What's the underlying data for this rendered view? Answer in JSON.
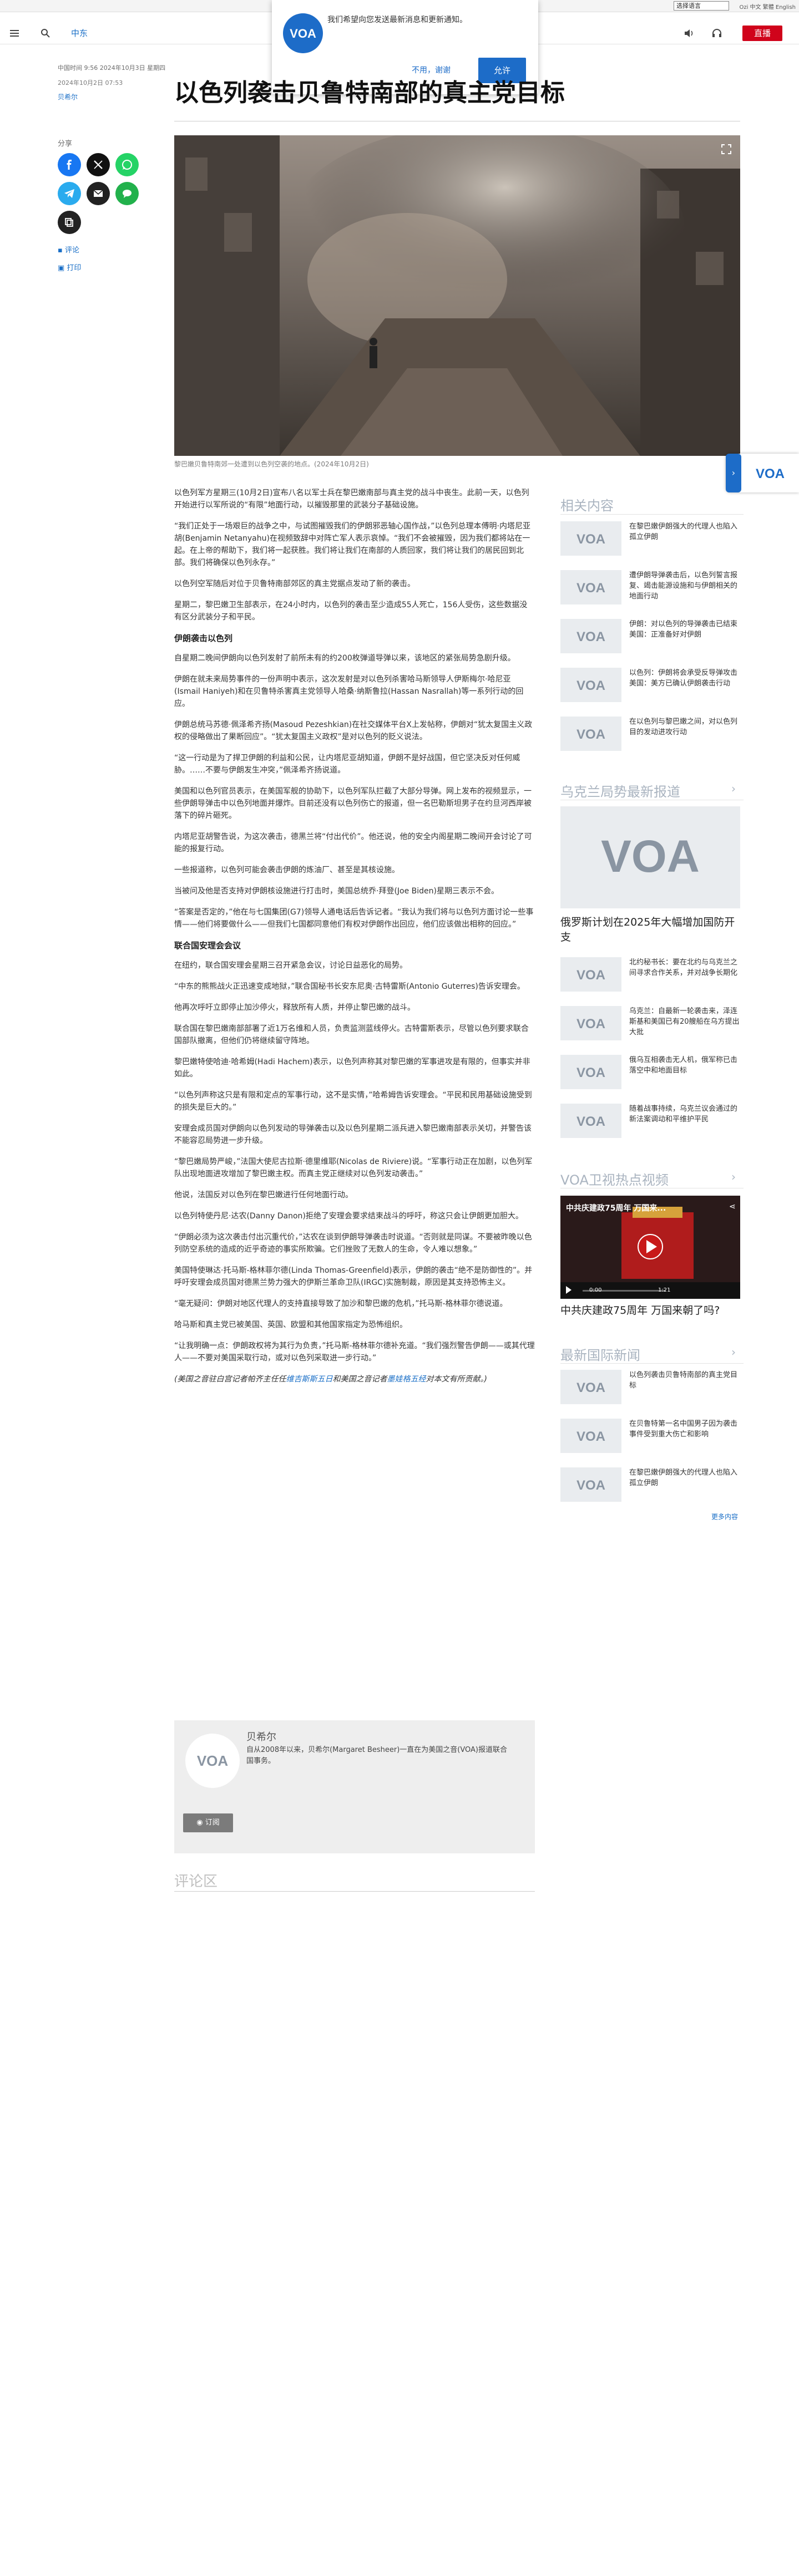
{
  "topbar": {
    "language_select": "选择语言",
    "links": "Ozi 中文 繁體 English"
  },
  "header": {
    "section": "中东",
    "live": "直播"
  },
  "notification": {
    "text": "我们希望向您发送最新消息和更新通知。",
    "later": "不用，谢谢",
    "allow": "允许"
  },
  "article": {
    "meta_lines": [
      "中国时间 9:56 2024年10月3日 星期四",
      "2024年10月2日 07:53"
    ],
    "author": "贝希尔",
    "headline": "以色列袭击贝鲁特南部的真主党目标",
    "share_label": "分享",
    "comment_link": "评论",
    "print_link": "打印",
    "caption": "黎巴嫩贝鲁特南郊一处遭到以色列空袭的地点。(2024年10月2日)",
    "blocks": [
      {
        "type": "p",
        "text": "以色列军方星期三(10月2日)宣布八名以军士兵在黎巴嫩南部与真主党的战斗中丧生。此前一天，以色列开始进行以军所说的“有限”地面行动，以摧毁那里的武装分子基础设施。"
      },
      {
        "type": "p",
        "text": "“我们正处于一场艰巨的战争之中，与试图摧毁我们的伊朗邪恶轴心国作战，”以色列总理本傅明·内塔尼亚胡(Benjamin Netanyahu)在视频致辞中对阵亡军人表示哀悼。“我们不会被摧毁，因为我们都将站在一起。在上帝的帮助下，我们将一起获胜。我们将让我们在南部的人质回家，我们将让我们的居民回到北部。我们将确保以色列永存。”"
      },
      {
        "type": "p",
        "text": "以色列空军随后对位于贝鲁特南部郊区的真主党据点发动了新的袭击。"
      },
      {
        "type": "p",
        "text": "星期二，黎巴嫩卫生部表示，在24小时内，以色列的袭击至少造成55人死亡，156人受伤，这些数据没有区分武装分子和平民。"
      },
      {
        "type": "h3",
        "text": "伊朗袭击以色列"
      },
      {
        "type": "p",
        "text": "自星期二晚间伊朗向以色列发射了前所未有的约200枚弹道导弹以来，该地区的紧张局势急剧升级。"
      },
      {
        "type": "p",
        "text": "伊朗在就未来局势事件的一份声明中表示，这次发射是对以色列杀害哈马斯领导人伊斯梅尔·哈尼亚(Ismail Haniyeh)和在贝鲁特杀害真主党领导人哈桑·纳斯鲁拉(Hassan Nasrallah)等一系列行动的回应。"
      },
      {
        "type": "p",
        "text": "伊朗总统马苏德·佩泽希齐扬(Masoud Pezeshkian)在社交媒体平台X上发帖称，伊朗对“犹太复国主义政权的侵略做出了果断回应”。“犹太复国主义政权”是对以色列的贬义说法。"
      },
      {
        "type": "p",
        "text": "“这一行动是为了捍卫伊朗的利益和公民，让内塔尼亚胡知道，伊朗不是好战国，但它坚决反对任何威胁。……不要与伊朗发生冲突，”佩泽希齐扬说道。"
      },
      {
        "type": "p",
        "text": "美国和以色列官员表示，在美国军舰的协助下，以色列军队拦截了大部分导弹。网上发布的视频显示，一些伊朗导弹击中以色列地面并爆炸。目前还没有以色列伤亡的报道，但一名巴勒斯坦男子在约旦河西岸被落下的碎片砸死。"
      },
      {
        "type": "p",
        "text": "内塔尼亚胡警告说，为这次袭击，德黑兰将“付出代价”。他还说，他的安全内阁星期二晚间开会讨论了可能的报复行动。"
      },
      {
        "type": "p",
        "text": "一些报道称，以色列可能会袭击伊朗的炼油厂、甚至是其核设施。"
      },
      {
        "type": "p",
        "text": "当被问及他是否支持对伊朗核设施进行打击时，美国总统乔·拜登(Joe Biden)星期三表示不会。"
      },
      {
        "type": "p",
        "text": "“答案是否定的，”他在与七国集团(G7)领导人通电话后告诉记者。“我认为我们将与以色列方面讨论一些事情——他们将要做什么——但我们七国都同意他们有权对伊朗作出回应，他们应该做出相称的回应。”"
      },
      {
        "type": "h3",
        "text": "联合国安理会会议"
      },
      {
        "type": "p",
        "text": "在纽约，联合国安理会星期三召开紧急会议，讨论日益恶化的局势。"
      },
      {
        "type": "p",
        "text": "“中东的熊熊战火正迅速变成地狱，”联合国秘书长安东尼奥·古特雷斯(Antonio Guterres)告诉安理会。"
      },
      {
        "type": "p",
        "text": "他再次呼吁立即停止加沙停火，释放所有人质，并停止黎巴嫩的战斗。"
      },
      {
        "type": "p",
        "text": "联合国在黎巴嫩南部部署了近1万名维和人员，负责监测蓝线停火。古特雷斯表示，尽管以色列要求联合国部队撤离，但他们仍将继续留守阵地。"
      },
      {
        "type": "p",
        "text": "黎巴嫩特使哈迪·哈希姆(Hadi Hachem)表示，以色列声称其对黎巴嫩的军事进攻是有限的，但事实并非如此。"
      },
      {
        "type": "p",
        "text": "“以色列声称这只是有限和定点的军事行动，这不是实情，”哈希姆告诉安理会。“平民和民用基础设施受到的损失是巨大的。”"
      },
      {
        "type": "p",
        "text": "安理会成员国对伊朗向以色列发动的导弹袭击以及以色列星期二派兵进入黎巴嫩南部表示关切，并警告该不能容忍局势进一步升级。"
      },
      {
        "type": "p",
        "text": "“黎巴嫩局势严峻，”法国大使尼古拉斯·德里维耶(Nicolas de Riviere)说。“军事行动正在加剧，以色列军队出现地面进攻增加了黎巴嫩主权。而真主党正继续对以色列发动袭击。”"
      },
      {
        "type": "p",
        "text": "他说，法国反对以色列在黎巴嫩进行任何地面行动。"
      },
      {
        "type": "p",
        "text": "以色列特使丹尼·达农(Danny Danon)拒绝了安理会要求结束战斗的呼吁，称这只会让伊朗更加胆大。"
      },
      {
        "type": "p",
        "text": "“伊朗必须为这次袭击付出沉重代价，”达农在谈到伊朗导弹袭击时说道。“否则就是同谋。不要被昨晚以色列防空系统的造成的近乎奇迹的事实所欺骗。它们挫败了无数人的生命，令人难以想象。”"
      },
      {
        "type": "p",
        "text": "美国特使琳达·托马斯-格林菲尔德(Linda Thomas-Greenfield)表示，伊朗的袭击“绝不是防御性的”。并呼吁安理会成员国对德黑兰势力强大的伊斯兰革命卫队(IRGC)实施制裁，原因是其支持恐怖主义。"
      },
      {
        "type": "p",
        "text": "“毫无疑问：伊朗对地区代理人的支持直接导致了加沙和黎巴嫩的危机，”托马斯-格林菲尔德说道。"
      },
      {
        "type": "p",
        "text": "哈马斯和真主党已被美国、英国、欧盟和其他国家指定为恐怖组织。"
      },
      {
        "type": "p",
        "text": "“让我明确一点：伊朗政权将为其行为负责，”托马斯-格林菲尔德补充道。“我们强烈警告伊朗——或其代理人——不要对美国采取行动，或对以色列采取进一步行动。”"
      }
    ],
    "note_prefix": "(美国之音驻白宫记者帕齐主任任",
    "note_link1": "维吉斯斯五日",
    "note_mid": "和美国之音记者",
    "note_link2": "墨娃格五经",
    "note_suffix": "对本文有所贡献。)"
  },
  "author_box": {
    "name": "贝希尔",
    "bio": "自从2008年以来，贝希尔(Margaret Besheer)一直在为美国之音(VOA)报道联合国事务。",
    "subscribe": "订阅"
  },
  "comments": {
    "heading": "评论区"
  },
  "rail": {
    "related_heading": "相关内容",
    "related": [
      "在黎巴嫩伊朗强大的代理人也陷入孤立伊朗",
      "遭伊朗导弹袭击后，以色列誓言报复、竭击能源设施和与伊朗相关的地面行动",
      "伊朗：对以色列的导弹袭击已结束 美国：正准备好对伊朗",
      "以色列：伊朗将会承受反导弹攻击 美国：美方已确认伊朗袭击行动",
      "在以色列与黎巴嫩之间，对以色列目的发动进攻行动"
    ],
    "ukraine_heading": "乌克兰局势最新报道",
    "ukraine_feature": "俄罗斯计划在2025年大幅增加国防开支",
    "ukraine": [
      "北约秘书长：要在北约与乌克兰之间寻求合作关系，并对战争长期化",
      "乌克兰：自最新一轮袭击来，泽连斯基和美国已有20艘船在乌方提出大批",
      "俄乌互相袭击无人机，俄军称已击落空中和地面目标",
      "随着战事持续，乌克兰议会通过的新法案调动和平维护平民"
    ],
    "video_heading": "VOA卫视热点视频",
    "video_overlay": "中共庆建政75周年 万国来...",
    "video_time": "0:00",
    "video_duration": "1:21",
    "video_title": "中共庆建政75周年 万国来朝了吗?",
    "intl_heading": "最新国际新闻",
    "intl": [
      "以色列袭击贝鲁特南部的真主党目标",
      "在贝鲁特第一名中国男子因为袭击事件受到重大伤亡和影响",
      "在黎巴嫩伊朗强大的代理人也陷入孤立伊朗"
    ],
    "more": "更多内容"
  },
  "colors": {
    "accent": "#1a6fc7",
    "live": "#d0031b",
    "voa_blue": "#1d6cc8"
  }
}
